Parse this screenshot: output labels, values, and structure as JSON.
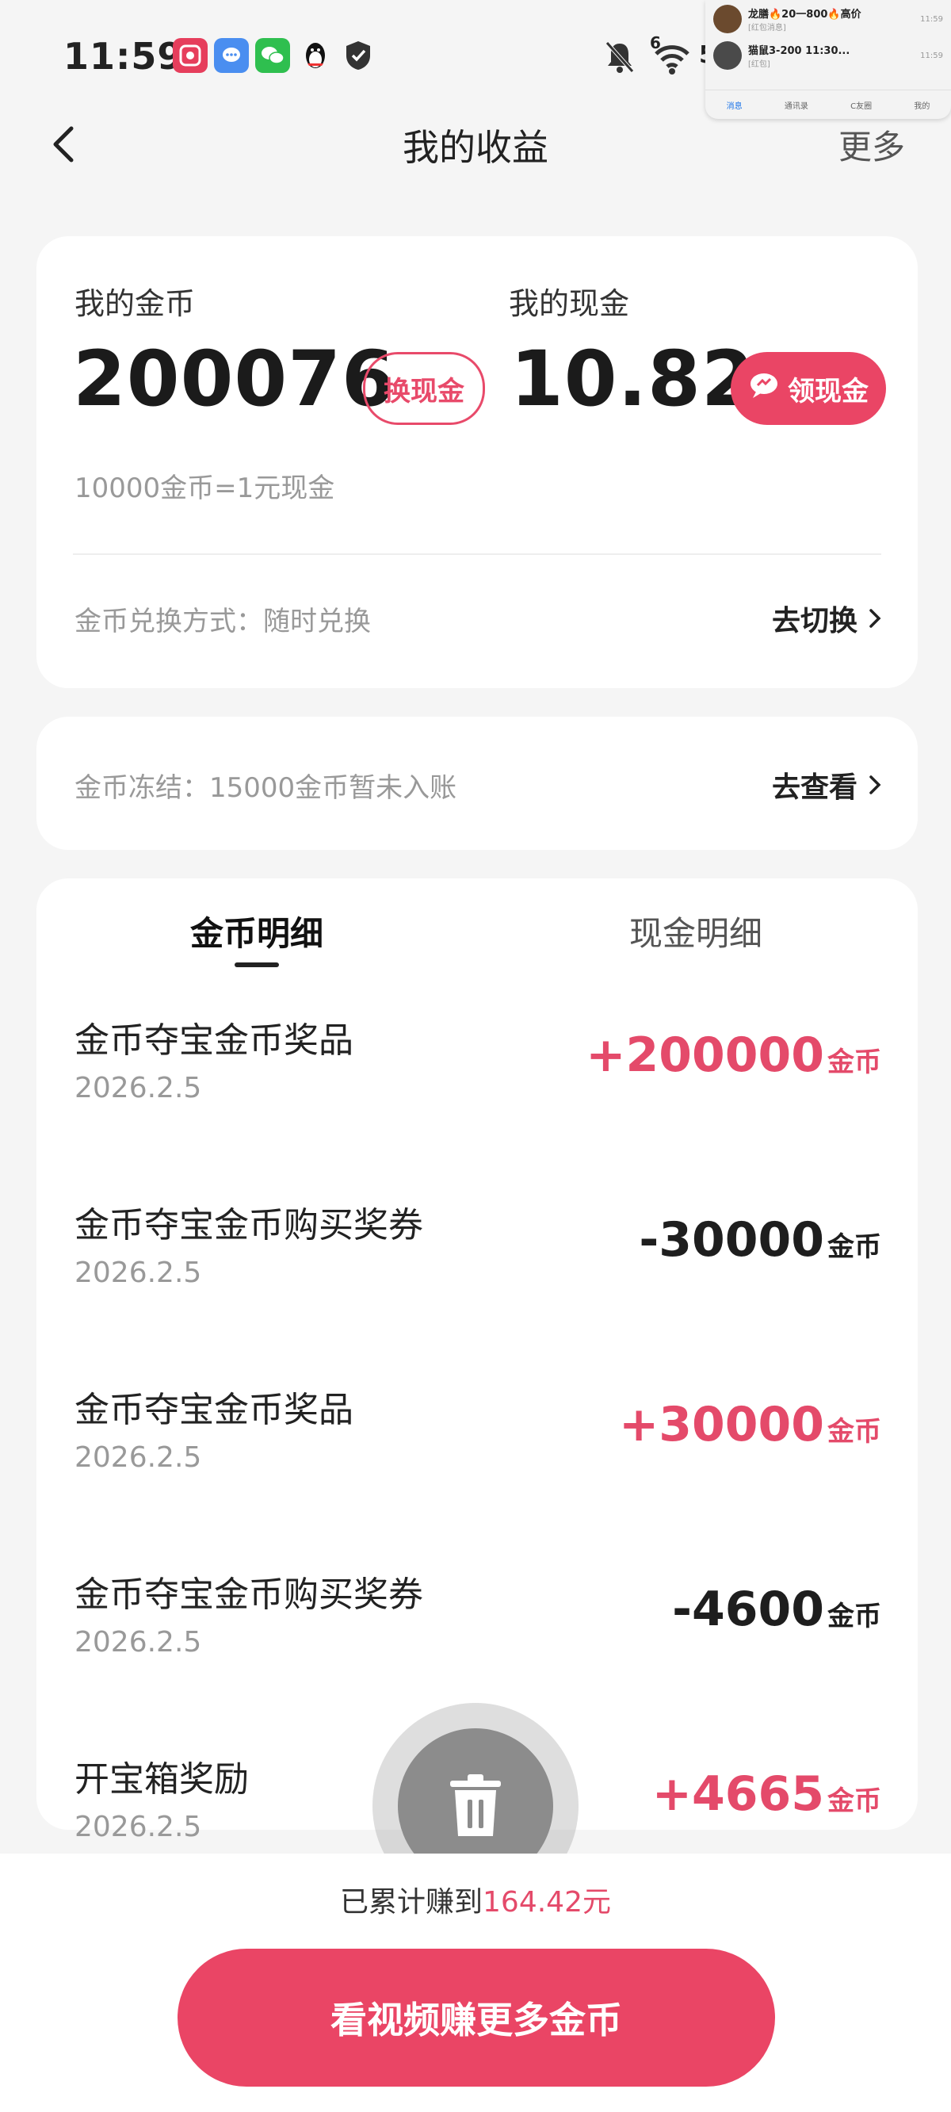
{
  "status_bar": {
    "time": "11:59",
    "app_icons": [
      "video-app-icon",
      "chat-bubble-icon",
      "wechat-icon",
      "qq-penguin-icon",
      "shield-check-icon"
    ],
    "network_label": "5G",
    "signal_label": "5G",
    "wifi_sup": "6",
    "battery_icon": "battery-charging-icon",
    "mute_icon": "bell-off-icon"
  },
  "notification": {
    "row1_title": "龙膳🔥20一800🔥高价",
    "row1_sub": "[红包消息]",
    "row1_time": "11:59",
    "row2_title": "猫鼠3-200 11:30...",
    "row2_sub": "[红包]",
    "row2_time": "11:59",
    "tabs": [
      "消息",
      "通讯录",
      "C友圈",
      "我的"
    ]
  },
  "header": {
    "title": "我的收益",
    "more": "更多"
  },
  "summary": {
    "coins_label": "我的金币",
    "coins_value": "200076",
    "exchange_button": "换现金",
    "cash_label": "我的现金",
    "cash_value": "10.82",
    "withdraw_button": "领现金",
    "rate_hint": "10000金币=1元现金",
    "exchange_mode_label": "金币兑换方式：随时兑换",
    "exchange_mode_link": "去切换"
  },
  "frozen": {
    "text": "金币冻结：15000金币暂未入账",
    "link": "去查看"
  },
  "tabs": {
    "coin_detail": "金币明细",
    "cash_detail": "现金明细"
  },
  "records": [
    {
      "title": "金币夺宝金币奖品",
      "date": "2026.2.5",
      "amount": "+200000",
      "unit": "金币",
      "type": "pos"
    },
    {
      "title": "金币夺宝金币购买奖券",
      "date": "2026.2.5",
      "amount": "-30000",
      "unit": "金币",
      "type": "neg"
    },
    {
      "title": "金币夺宝金币奖品",
      "date": "2026.2.5",
      "amount": "+30000",
      "unit": "金币",
      "type": "pos"
    },
    {
      "title": "金币夺宝金币购买奖券",
      "date": "2026.2.5",
      "amount": "-4600",
      "unit": "金币",
      "type": "neg"
    },
    {
      "title": "开宝箱奖励",
      "date": "2026.2.5",
      "amount": "+4665",
      "unit": "金币",
      "type": "pos"
    }
  ],
  "footer": {
    "earned_prefix": "已累计赚到",
    "earned_value": "164.42元",
    "cta": "看视频赚更多金币"
  },
  "colors": {
    "accent": "#ea4565",
    "positive": "#e44a6a",
    "negative": "#1e1e1e",
    "background": "#f5f5f5"
  }
}
